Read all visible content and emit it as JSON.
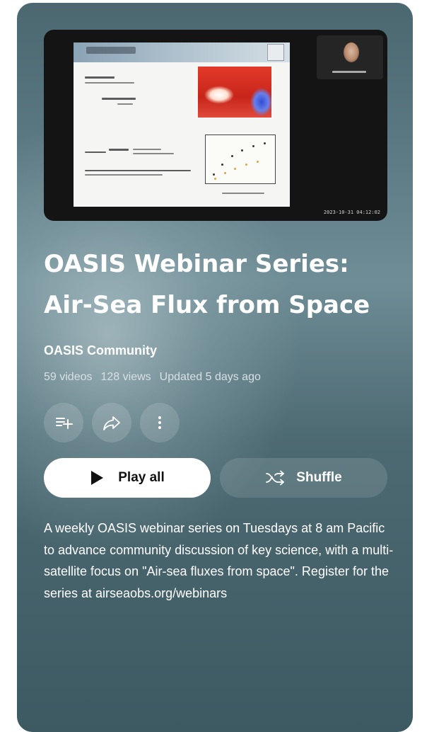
{
  "playlist": {
    "title_line1": "OASIS Webinar Series:",
    "title_line2": "Air-Sea Flux from Space",
    "channel": "OASIS Community",
    "video_count": "59 videos",
    "views": "128 views",
    "updated": "Updated 5 days ago",
    "description": "A weekly OASIS webinar series on Tuesdays at 8 am Pacific to advance community discussion of key science, with a multi-satellite focus on \"Air-sea fluxes from space\".  Register for the series at airseaobs.org/webinars"
  },
  "thumbnail": {
    "timestamp": "2023-10-31 04:12:02"
  },
  "actions": {
    "save_icon": "playlist-add-icon",
    "share_icon": "share-icon",
    "more_icon": "more-vert-icon",
    "play_all_label": "Play all",
    "play_icon": "play-icon",
    "shuffle_label": "Shuffle",
    "shuffle_icon": "shuffle-icon"
  },
  "colors": {
    "card_bg": "#4b6770",
    "play_button_bg": "#ffffff",
    "text": "#ffffff"
  }
}
